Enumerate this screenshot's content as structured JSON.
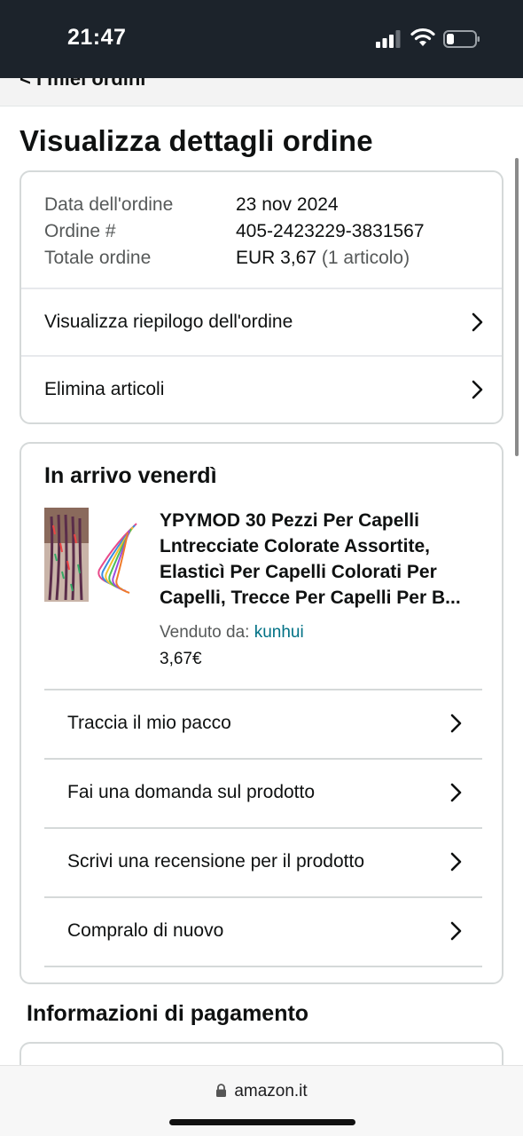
{
  "status_bar": {
    "time": "21:47"
  },
  "nav": {
    "back_crumb": "< I miei ordini"
  },
  "page": {
    "title": "Visualizza dettagli ordine"
  },
  "order_summary": {
    "date_label": "Data dell'ordine",
    "date_value": "23 nov 2024",
    "number_label": "Ordine #",
    "number_value": "405-2423229-3831567",
    "total_label": "Totale ordine",
    "total_value": "EUR 3,67",
    "total_items": "(1 articolo)"
  },
  "order_links": [
    {
      "label": "Visualizza riepilogo dell'ordine"
    },
    {
      "label": "Elimina articoli"
    }
  ],
  "shipment": {
    "arrival": "In arrivo venerdì",
    "product_title": "YPYMOD 30 Pezzi Per Capelli Lntrecciate Colorate Assortite, Elasticì Per Capelli Colorati Per Capelli, Trecce Per Capelli Per B...",
    "seller_label": "Venduto da:",
    "seller_name": "kunhui",
    "price": "3,67€",
    "actions": [
      {
        "label": "Traccia il mio pacco"
      },
      {
        "label": "Fai una domanda sul prodotto"
      },
      {
        "label": "Scrivi una recensione per il prodotto"
      },
      {
        "label": "Compralo di nuovo"
      }
    ]
  },
  "payment": {
    "title": "Informazioni di pagamento"
  },
  "browser": {
    "url": "amazon.it"
  },
  "icons": {
    "chevron": "chevron-right-icon",
    "lock": "lock-icon",
    "wifi": "wifi-icon",
    "signal": "signal-icon",
    "battery": "battery-icon"
  },
  "colors": {
    "link": "#007185",
    "status_bar": "#1c232b",
    "border": "#d5d9d9"
  }
}
